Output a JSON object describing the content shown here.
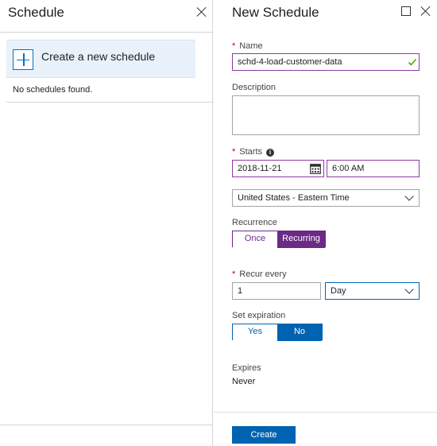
{
  "left_blade": {
    "title": "Schedule",
    "create_label": "Create a new schedule",
    "empty_message": "No schedules found."
  },
  "right_blade": {
    "title": "New Schedule",
    "name": {
      "label": "Name",
      "value": "schd-4-load-customer-data",
      "required": true
    },
    "description": {
      "label": "Description",
      "value": ""
    },
    "starts": {
      "label": "Starts",
      "date": "2018-11-21",
      "time": "6:00 AM",
      "required": true
    },
    "timezone": {
      "selected": "United States - Eastern Time"
    },
    "recurrence": {
      "label": "Recurrence",
      "options": [
        "Once",
        "Recurring"
      ],
      "selected": "Recurring"
    },
    "recur_every": {
      "label": "Recur every",
      "value": "1",
      "unit": "Day",
      "required": true
    },
    "set_expiration": {
      "label": "Set expiration",
      "options": [
        "Yes",
        "No"
      ],
      "selected": "No"
    },
    "expires": {
      "label": "Expires",
      "value": "Never"
    },
    "create_button": "Create"
  },
  "colors": {
    "accent_blue": "#0063b1",
    "accent_purple": "#6b2a85",
    "required_red": "#c4001e",
    "valid_green": "#57a300",
    "selected_bg": "#e9f1fa"
  }
}
